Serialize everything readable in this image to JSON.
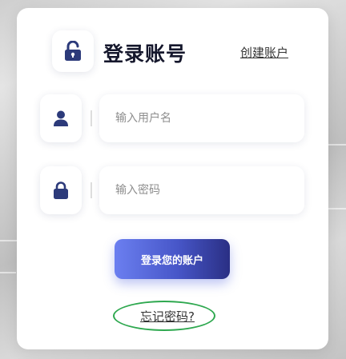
{
  "header": {
    "title": "登录账号",
    "create_account_link": "创建账户"
  },
  "form": {
    "username": {
      "placeholder": "输入用户名",
      "value": "",
      "icon": "user-icon"
    },
    "password": {
      "placeholder": "输入密码",
      "value": "",
      "icon": "lock-icon"
    },
    "submit_label": "登录您的账户",
    "forgot_password_link": "忘记密码?"
  },
  "annotation": {
    "highlight_color": "#2ea84f"
  },
  "colors": {
    "accent": "#4756c8",
    "icon": "#2c3a7a",
    "title": "#15172c"
  }
}
